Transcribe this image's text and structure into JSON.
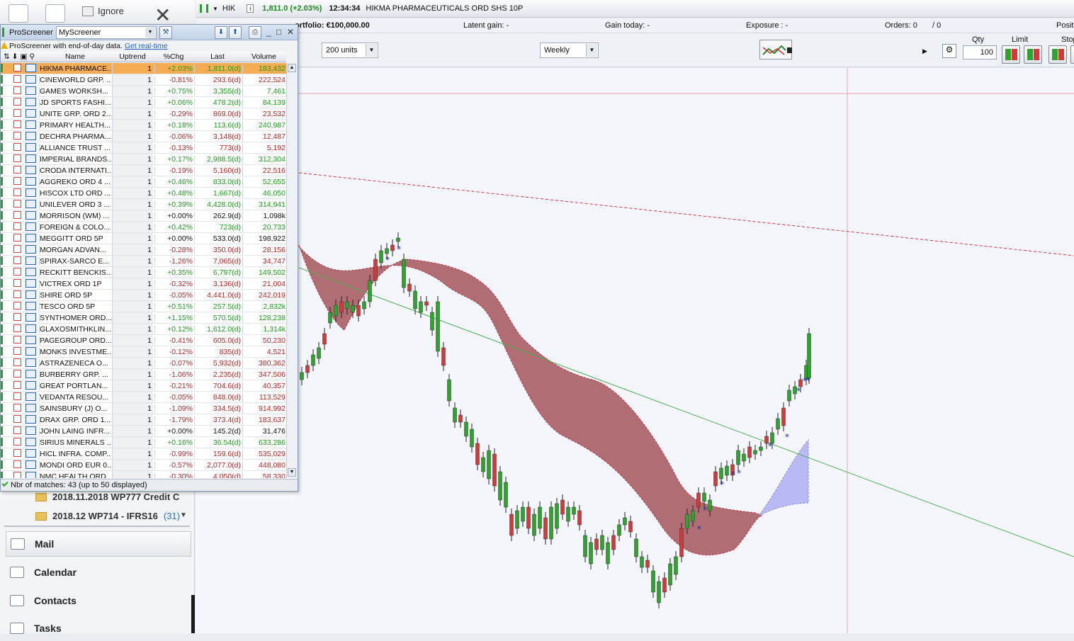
{
  "outlook": {
    "ignore_label": "Ignore",
    "folders": [
      {
        "name": "2018.11.2018 WP777 Credit C",
        "count": ""
      },
      {
        "name": "2018.12 WP714 - IFRS16",
        "count": "(31)"
      }
    ],
    "nav": [
      {
        "label": "Mail"
      },
      {
        "label": "Calendar"
      },
      {
        "label": "Contacts"
      },
      {
        "label": "Tasks"
      }
    ]
  },
  "topbar": {
    "ticker": "HIK",
    "info_icon": "i",
    "price_change": "1,811.0 (+2.03%)",
    "time": "12:34:34",
    "instrument": "HIKMA PHARMACEUTICALS ORD SHS 10P"
  },
  "portfolio": {
    "portfolio": "ortfolio: €100,000.00",
    "latent_gain": "Latent gain: -",
    "gain_today": "Gain today: -",
    "exposure": "Exposure : -",
    "orders": "Orders: 0",
    "orders2": "/ 0",
    "position": "Posit"
  },
  "order_bar": {
    "units": "200 units",
    "timeframe": "Weekly",
    "qty_label": "Qty",
    "qty_value": "100",
    "limit_label": "Limit",
    "stop_label": "Stop"
  },
  "screener": {
    "title": "ProScreener",
    "selected_screener": "MyScreener",
    "notice": "ProScreener with end-of-day data.",
    "notice_link": "Get real-time",
    "columns": {
      "name": "Name",
      "uptrend": "Uptrend",
      "chg": "%Chg",
      "last": "Last",
      "volume": "Volume"
    },
    "status": "Nbr of matches: 43 (up to 50 displayed)",
    "rows": [
      {
        "name": "HIKMA PHARMACE...",
        "up": "1",
        "chg": "+2.03%",
        "last": "1,811.0(d)",
        "vol": "183,432",
        "dir": "pos",
        "sel": true
      },
      {
        "name": "CINEWORLD GRP. ...",
        "up": "1",
        "chg": "-0.81%",
        "last": "293.6(d)",
        "vol": "222,524",
        "dir": "neg"
      },
      {
        "name": "GAMES WORKSH...",
        "up": "1",
        "chg": "+0.75%",
        "last": "3,355(d)",
        "vol": "7,461",
        "dir": "pos"
      },
      {
        "name": "JD SPORTS FASHI...",
        "up": "1",
        "chg": "+0.06%",
        "last": "478.2(d)",
        "vol": "84,139",
        "dir": "pos"
      },
      {
        "name": "UNITE GRP. ORD 2...",
        "up": "1",
        "chg": "-0.29%",
        "last": "869.0(d)",
        "vol": "23,532",
        "dir": "neg"
      },
      {
        "name": "PRIMARY HEALTH...",
        "up": "1",
        "chg": "+0.18%",
        "last": "113.6(d)",
        "vol": "240,987",
        "dir": "pos"
      },
      {
        "name": "DECHRA PHARMA...",
        "up": "1",
        "chg": "-0.06%",
        "last": "3,148(d)",
        "vol": "12,487",
        "dir": "neg"
      },
      {
        "name": "ALLIANCE TRUST ...",
        "up": "1",
        "chg": "-0.13%",
        "last": "773(d)",
        "vol": "5,192",
        "dir": "neg"
      },
      {
        "name": "IMPERIAL BRANDS...",
        "up": "1",
        "chg": "+0.17%",
        "last": "2,988.5(d)",
        "vol": "312,304",
        "dir": "pos"
      },
      {
        "name": "CRODA INTERNATI...",
        "up": "1",
        "chg": "-0.19%",
        "last": "5,160(d)",
        "vol": "22,516",
        "dir": "neg"
      },
      {
        "name": "AGGREKO ORD 4 ...",
        "up": "1",
        "chg": "+0.46%",
        "last": "833.0(d)",
        "vol": "52,655",
        "dir": "pos"
      },
      {
        "name": "HISCOX LTD ORD ...",
        "up": "1",
        "chg": "+0.48%",
        "last": "1,667(d)",
        "vol": "46,050",
        "dir": "pos"
      },
      {
        "name": "UNILEVER ORD 3 ...",
        "up": "1",
        "chg": "+0.39%",
        "last": "4,428.0(d)",
        "vol": "314,941",
        "dir": "pos"
      },
      {
        "name": "MORRISON (WM) ...",
        "up": "1",
        "chg": "+0.00%",
        "last": "262.9(d)",
        "vol": "1,098k",
        "dir": "neu"
      },
      {
        "name": "FOREIGN & COLO...",
        "up": "1",
        "chg": "+0.42%",
        "last": "723(d)",
        "vol": "20,733",
        "dir": "pos"
      },
      {
        "name": "MEGGITT ORD 5P",
        "up": "1",
        "chg": "+0.00%",
        "last": "533.0(d)",
        "vol": "198,922",
        "dir": "neu"
      },
      {
        "name": "MORGAN ADVAN...",
        "up": "1",
        "chg": "-0.28%",
        "last": "350.0(d)",
        "vol": "28,156",
        "dir": "neg"
      },
      {
        "name": "SPIRAX-SARCO E...",
        "up": "1",
        "chg": "-1.26%",
        "last": "7,065(d)",
        "vol": "34,747",
        "dir": "neg"
      },
      {
        "name": "RECKITT BENCKIS...",
        "up": "1",
        "chg": "+0.35%",
        "last": "6,797(d)",
        "vol": "149,502",
        "dir": "pos"
      },
      {
        "name": "VICTREX ORD 1P",
        "up": "1",
        "chg": "-0.32%",
        "last": "3,136(d)",
        "vol": "21,004",
        "dir": "neg"
      },
      {
        "name": "SHIRE ORD 5P",
        "up": "1",
        "chg": "-0.05%",
        "last": "4,441.0(d)",
        "vol": "242,019",
        "dir": "neg"
      },
      {
        "name": "TESCO ORD 5P",
        "up": "1",
        "chg": "+0.51%",
        "last": "257.5(d)",
        "vol": "2,832k",
        "dir": "pos"
      },
      {
        "name": "SYNTHOMER ORD...",
        "up": "1",
        "chg": "+1.15%",
        "last": "570.5(d)",
        "vol": "128,238",
        "dir": "pos"
      },
      {
        "name": "GLAXOSMITHKLIN...",
        "up": "1",
        "chg": "+0.12%",
        "last": "1,612.0(d)",
        "vol": "1,314k",
        "dir": "pos"
      },
      {
        "name": "PAGEGROUP ORD...",
        "up": "1",
        "chg": "-0.41%",
        "last": "605.0(d)",
        "vol": "50,230",
        "dir": "neg"
      },
      {
        "name": "MONKS INVESTME...",
        "up": "1",
        "chg": "-0.12%",
        "last": "835(d)",
        "vol": "4,521",
        "dir": "neg"
      },
      {
        "name": "ASTRAZENECA O...",
        "up": "1",
        "chg": "-0.07%",
        "last": "5,932(d)",
        "vol": "380,362",
        "dir": "neg"
      },
      {
        "name": "BURBERRY GRP. ...",
        "up": "1",
        "chg": "-1.06%",
        "last": "2,235(d)",
        "vol": "347,506",
        "dir": "neg"
      },
      {
        "name": "GREAT PORTLAN...",
        "up": "1",
        "chg": "-0.21%",
        "last": "704.6(d)",
        "vol": "40,357",
        "dir": "neg"
      },
      {
        "name": "VEDANTA RESOU...",
        "up": "1",
        "chg": "-0.05%",
        "last": "848.0(d)",
        "vol": "113,529",
        "dir": "neg"
      },
      {
        "name": "SAINSBURY (J) O...",
        "up": "1",
        "chg": "-1.09%",
        "last": "334.5(d)",
        "vol": "914,992",
        "dir": "neg"
      },
      {
        "name": "DRAX GRP. ORD 1...",
        "up": "1",
        "chg": "-1.79%",
        "last": "373.4(d)",
        "vol": "183,637",
        "dir": "neg"
      },
      {
        "name": "JOHN LAING INFR...",
        "up": "1",
        "chg": "+0.00%",
        "last": "145.2(d)",
        "vol": "31,476",
        "dir": "neu"
      },
      {
        "name": "SIRIUS MINERALS ...",
        "up": "1",
        "chg": "+0.16%",
        "last": "36.54(d)",
        "vol": "633,286",
        "dir": "pos"
      },
      {
        "name": "HICL INFRA. COMP...",
        "up": "1",
        "chg": "-0.99%",
        "last": "159.6(d)",
        "vol": "535,029",
        "dir": "neg"
      },
      {
        "name": "MONDI ORD EUR 0...",
        "up": "1",
        "chg": "-0.57%",
        "last": "2,077.0(d)",
        "vol": "448,080",
        "dir": "neg"
      },
      {
        "name": "NMC HEALTH ORD...",
        "up": "1",
        "chg": "-0.30%",
        "last": "4,050(d)",
        "vol": "58,330",
        "dir": "neg"
      }
    ]
  },
  "colors": {
    "up": "#2da52d",
    "down": "#d23a3a",
    "cloud_fill": "#a5555c",
    "cloud_fill_alt": "#b3b3f5",
    "trend_green": "#4caf50",
    "trend_red": "#e0303a",
    "selected_row": "#f5ac52"
  }
}
